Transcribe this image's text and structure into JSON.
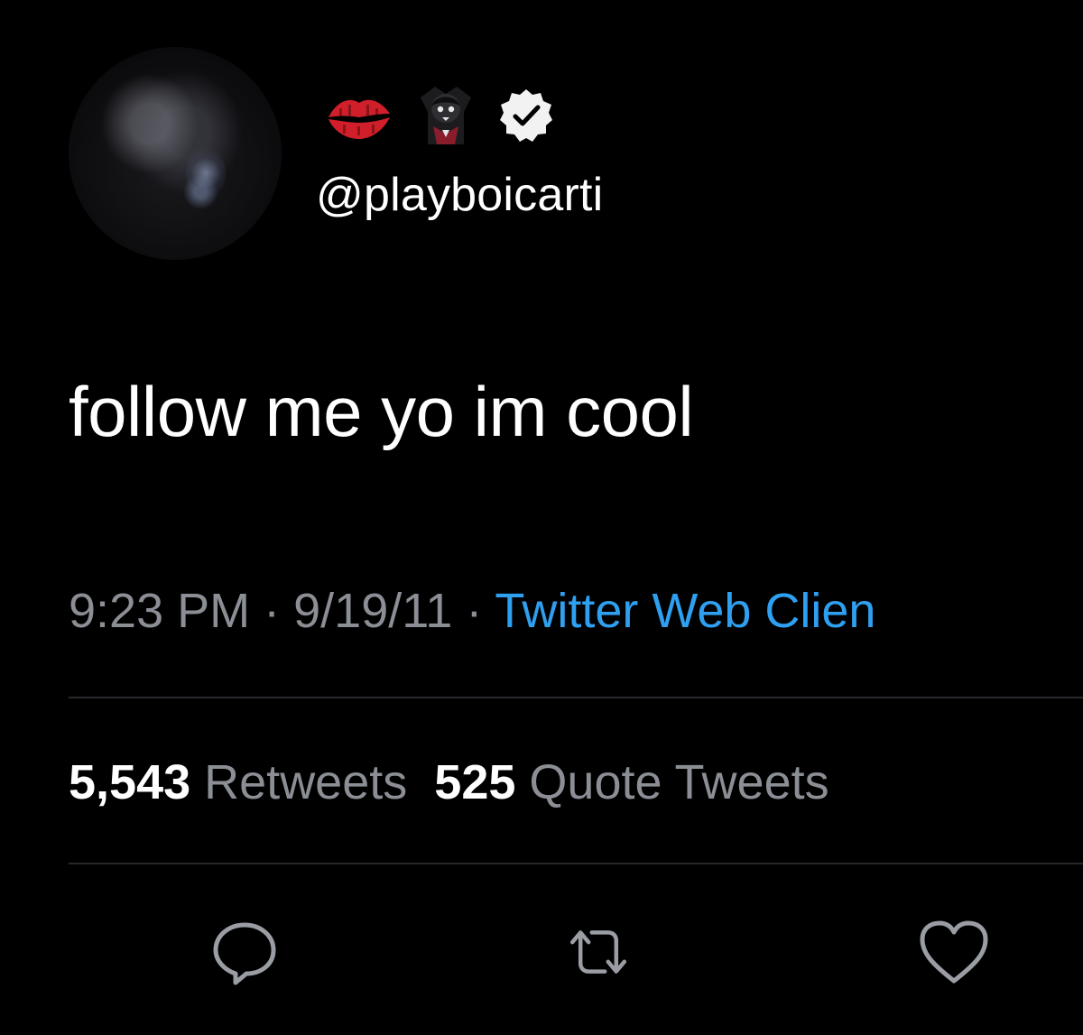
{
  "tweet": {
    "author": {
      "handle": "@playboicarti",
      "name_emojis": [
        "kiss-mark-icon",
        "vampire-icon"
      ],
      "verified": true,
      "avatar": "avatar"
    },
    "text": "follow me yo im cool",
    "meta": {
      "time": "9:23 PM",
      "separator": "·",
      "date": "9/19/11",
      "source": "Twitter Web Clien"
    },
    "stats": {
      "retweets_count": "5,543",
      "retweets_label": "Retweets",
      "quote_tweets_count": "525",
      "quote_tweets_label": "Quote Tweets"
    },
    "actions": [
      "reply-icon",
      "retweet-icon",
      "like-icon"
    ]
  },
  "colors": {
    "background": "#000000",
    "text": "#ffffff",
    "muted": "#8b8e94",
    "link": "#2f9ff0",
    "divider": "#26282c",
    "kiss": "#d01f2a"
  }
}
